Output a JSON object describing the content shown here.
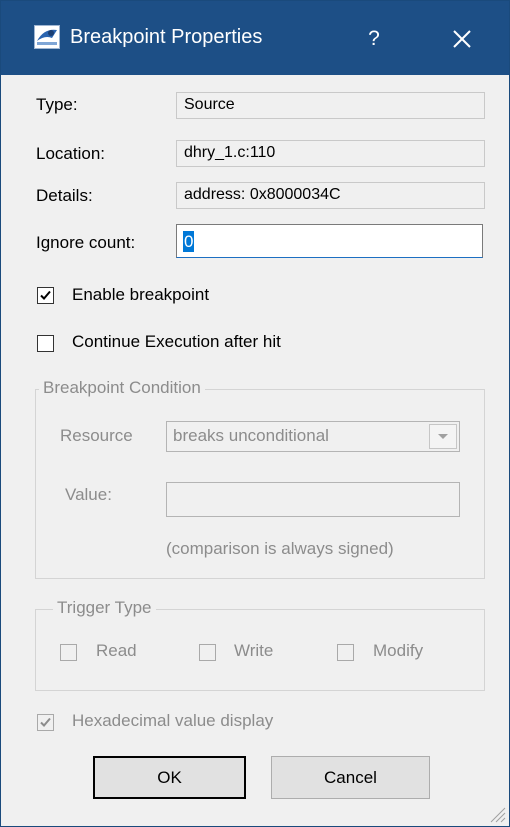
{
  "window": {
    "title": "Breakpoint Properties",
    "help_glyph": "?",
    "accent": "#1d4f86"
  },
  "fields": {
    "type_label": "Type:",
    "type_value": "Source",
    "location_label": "Location:",
    "location_value": "dhry_1.c:110",
    "details_label": "Details:",
    "details_value": "address: 0x8000034C",
    "ignore_label": "Ignore count:",
    "ignore_value": "0"
  },
  "options": {
    "enable_label": "Enable breakpoint",
    "enable_checked": true,
    "continue_label": "Continue Execution after hit",
    "continue_checked": false
  },
  "condition": {
    "group_title": "Breakpoint Condition",
    "resource_label": "Resource",
    "resource_value": "breaks unconditional",
    "value_label": "Value:",
    "value_value": "",
    "note": "(comparison is always signed)"
  },
  "trigger": {
    "group_title": "Trigger Type",
    "read_label": "Read",
    "write_label": "Write",
    "modify_label": "Modify"
  },
  "hex": {
    "label": "Hexadecimal value display",
    "checked": true
  },
  "buttons": {
    "ok": "OK",
    "cancel": "Cancel"
  }
}
